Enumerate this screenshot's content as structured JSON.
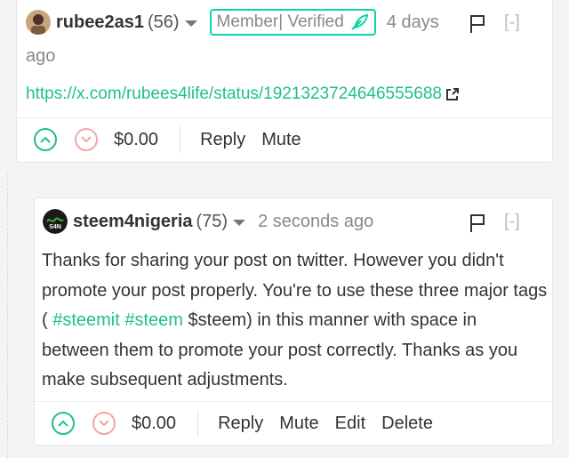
{
  "comment1": {
    "author": "rubee2as1",
    "reputation": "(56)",
    "badge_label": "Member| Verified",
    "time_part1": "4 days",
    "time_part2": "ago",
    "collapse_label": "[-]",
    "link": "https://x.com/rubees4life/status/1921323724646555688",
    "payout": "$0.00",
    "actions": {
      "reply": "Reply",
      "mute": "Mute"
    }
  },
  "comment2": {
    "author": "steem4nigeria",
    "reputation": "(75)",
    "time": "2 seconds ago",
    "collapse_label": "[-]",
    "body": {
      "part1": "Thanks for sharing your post on twitter. However you didn't promote your post properly. You're to use these three major tags ( ",
      "tag1": "#steemit",
      "space": " ",
      "tag2": "#steem",
      "part2": " $steem) in this manner with space in between them to promote your post correctly. Thanks as you make subsequent adjustments."
    },
    "payout": "$0.00",
    "actions": {
      "reply": "Reply",
      "mute": "Mute",
      "edit": "Edit",
      "delete": "Delete"
    }
  },
  "avatar2_text": "S4N",
  "icons": {
    "caret": "chevron-down-icon",
    "flag": "flag-icon",
    "badge": "quill-icon",
    "link": "external-link-icon",
    "upvote": "upvote-icon",
    "downvote": "downvote-icon"
  },
  "colors": {
    "accent": "#1fbf8f",
    "badge_border": "#06d6a9",
    "downvote": "#f0a8a8",
    "muted": "#888888"
  }
}
